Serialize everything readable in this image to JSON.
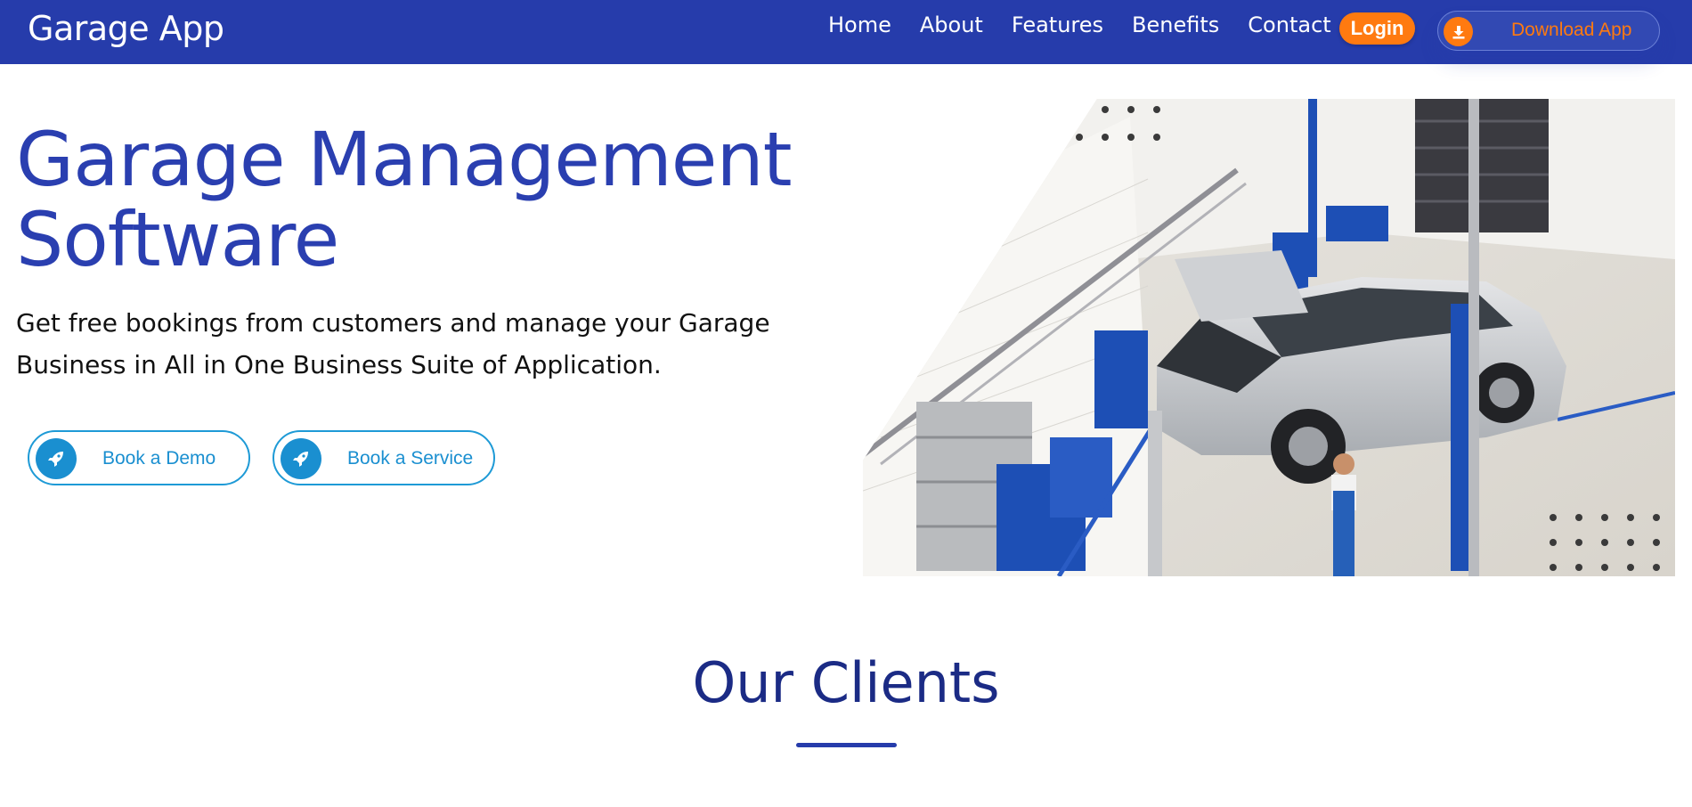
{
  "navbar": {
    "brand": "Garage App",
    "links": [
      "Home",
      "About",
      "Features",
      "Benefits",
      "Contact"
    ],
    "login_label": "Login",
    "download_label": "Download App",
    "download_icon": "download-icon",
    "background_color": "#263cab",
    "accent_color": "#ff7a10"
  },
  "hero": {
    "title_line1": "Garage Management",
    "title_line2": "Software",
    "subtitle_line1": "Get free bookings from customers and manage your Garage",
    "subtitle_line2": "Business in All in One Business Suite of Application.",
    "buttons": [
      {
        "label": "Book a Demo",
        "icon": "rocket-icon"
      },
      {
        "label": "Book a Service",
        "icon": "rocket-icon"
      }
    ],
    "title_color": "#2a3fb0",
    "button_color": "#1a8fd0"
  },
  "clients": {
    "title": "Our Clients"
  }
}
